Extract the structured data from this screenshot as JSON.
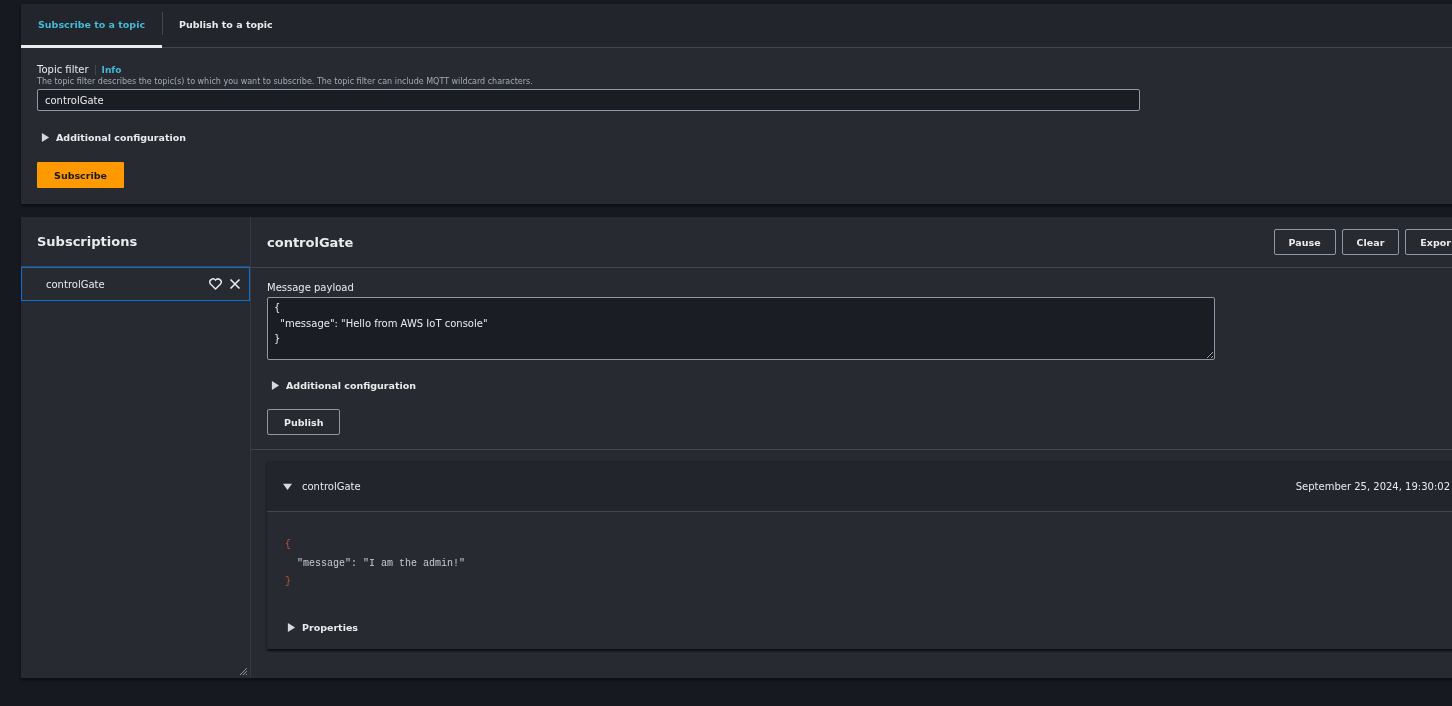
{
  "tabs": [
    {
      "label": "Subscribe to a topic",
      "selected": true
    },
    {
      "label": "Publish to a topic",
      "selected": false
    }
  ],
  "topic_filter": {
    "label": "Topic filter",
    "info": "Info",
    "description": "The topic filter describes the topic(s) to which you want to subscribe. The topic filter can include MQTT wildcard characters.",
    "value": "controlGate"
  },
  "subscribe_config": {
    "label": "Additional configuration",
    "expanded": false
  },
  "subscribe_button": "Subscribe",
  "subscriptions": {
    "title": "Subscriptions",
    "items": [
      {
        "label": "controlGate",
        "selected": true
      }
    ]
  },
  "topic_view": {
    "title": "controlGate",
    "buttons": [
      "Pause",
      "Clear",
      "Expor"
    ],
    "payload_label": "Message payload",
    "payload": "{\n  \"message\": \"Hello from AWS IoT console\"\n}",
    "config": {
      "label": "Additional configuration",
      "expanded": false
    },
    "publish_button": "Publish",
    "messages": [
      {
        "topic": "controlGate",
        "expanded": true,
        "timestamp": "September 25, 2024, 19:30:02",
        "lines": [
          {
            "kind": "brace",
            "text": "{"
          },
          {
            "kind": "text",
            "text": "  \"message\": \"I am the admin!\""
          },
          {
            "kind": "brace",
            "text": "}"
          }
        ],
        "properties": {
          "label": "Properties",
          "expanded": false
        }
      }
    ]
  }
}
